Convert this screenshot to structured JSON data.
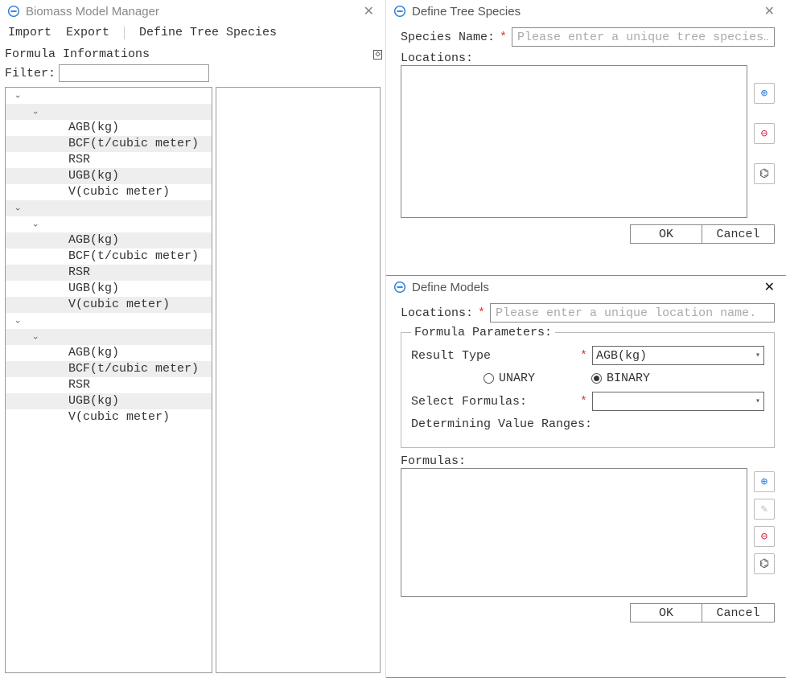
{
  "left": {
    "title": "Biomass Model Manager",
    "menu": {
      "import": "Import",
      "export": "Export",
      "define": "Define Tree Species"
    },
    "panel_title": "Formula Informations",
    "filter_label": "Filter:",
    "tree_groups": [
      {
        "items": [
          "AGB(kg)",
          "BCF(t/cubic meter)",
          "RSR",
          "UGB(kg)",
          "V(cubic meter)"
        ]
      },
      {
        "items": [
          "AGB(kg)",
          "BCF(t/cubic meter)",
          "RSR",
          "UGB(kg)",
          "V(cubic meter)"
        ]
      },
      {
        "items": [
          "AGB(kg)",
          "BCF(t/cubic meter)",
          "RSR",
          "UGB(kg)",
          "V(cubic meter)"
        ]
      }
    ]
  },
  "species": {
    "title": "Define Tree Species",
    "name_label": "Species Name:",
    "name_placeholder": "Please enter a unique tree species…",
    "locations_label": "Locations:",
    "ok": "OK",
    "cancel": "Cancel"
  },
  "models": {
    "title": "Define Models",
    "locations_label": "Locations:",
    "locations_placeholder": "Please enter a unique location name.",
    "fp_legend": "Formula Parameters:",
    "result_type_label": "Result Type",
    "result_type_value": "AGB(kg)",
    "unary": "UNARY",
    "binary": "BINARY",
    "select_formulas_label": "Select Formulas:",
    "ranges_label": "Determining Value Ranges:",
    "formulas_label": "Formulas:",
    "ok": "OK",
    "cancel": "Cancel"
  }
}
